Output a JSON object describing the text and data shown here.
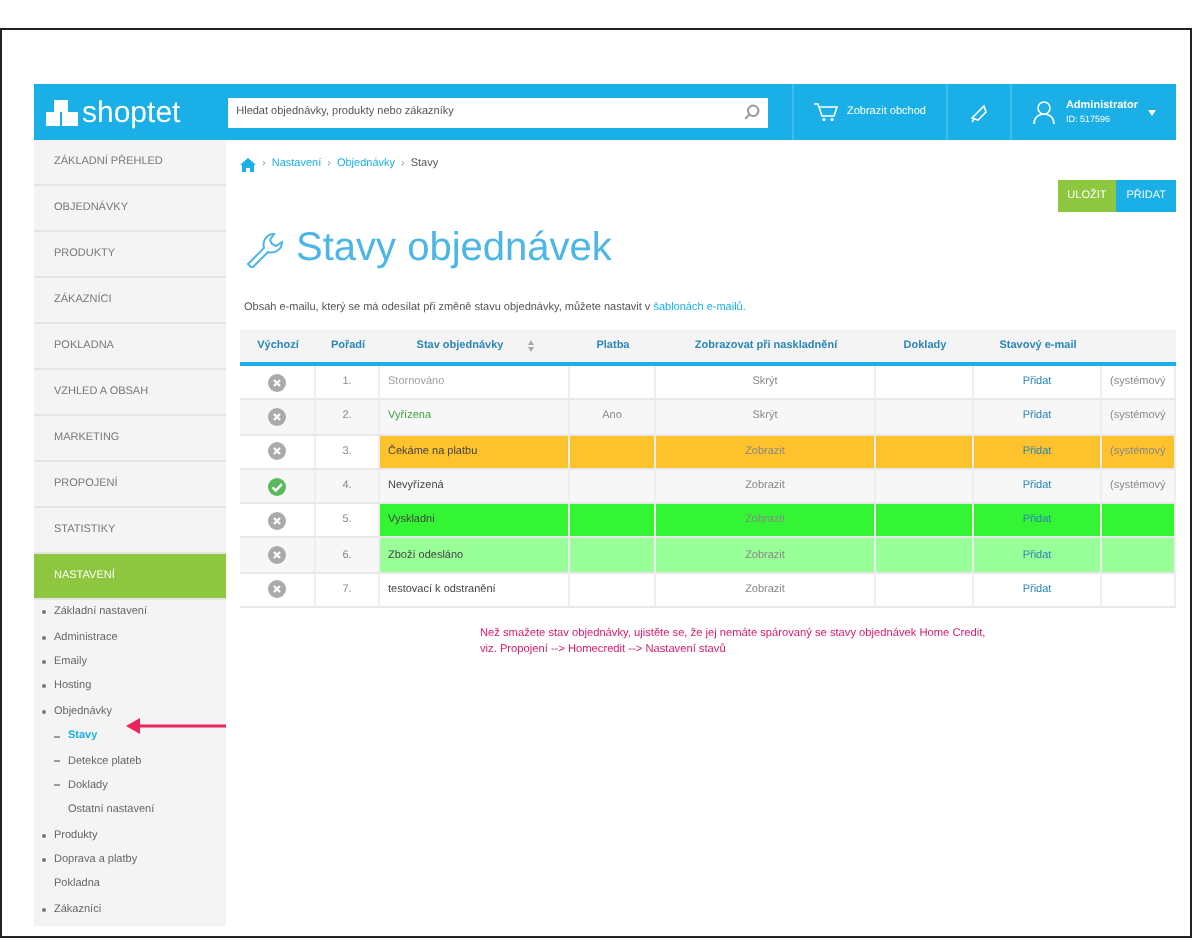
{
  "header": {
    "logo": "shoptet",
    "search": {
      "placeholder": "Hledat objednávky, produkty nebo zákazníky"
    },
    "shop_link": "Zobrazit obchod",
    "user": {
      "name": "Administrator",
      "id": "ID: 517596"
    }
  },
  "sidebar": {
    "items": [
      {
        "label": "ZÁKLADNÍ PŘEHLED",
        "selected": false
      },
      {
        "label": "OBJEDNÁVKY",
        "selected": false
      },
      {
        "label": "PRODUKTY",
        "selected": false
      },
      {
        "label": "ZÁKAZNÍCI",
        "selected": false
      },
      {
        "label": "POKLADNA",
        "selected": false
      },
      {
        "label": "VZHLED A OBSAH",
        "selected": false
      },
      {
        "label": "MARKETING",
        "selected": false
      },
      {
        "label": "PROPOJENÍ",
        "selected": false
      },
      {
        "label": "STATISTIKY",
        "selected": false
      },
      {
        "label": "NASTAVENÍ",
        "selected": true
      }
    ],
    "tree": [
      {
        "label": "Základní nastavení",
        "bullet": true,
        "selected": false
      },
      {
        "label": "Administrace",
        "bullet": true,
        "selected": false
      },
      {
        "label": "Emaily",
        "bullet": true,
        "selected": false
      },
      {
        "label": "Hosting",
        "bullet": true,
        "selected": false
      },
      {
        "label": "Objednávky",
        "bullet": true,
        "selected": false,
        "children": [
          {
            "label": "Stavy",
            "bullet": true,
            "selected": true
          },
          {
            "label": "Detekce plateb",
            "bullet": true,
            "selected": false
          },
          {
            "label": "Doklady",
            "bullet": true,
            "selected": false
          },
          {
            "label": "Ostatní nastavení",
            "bullet": false,
            "selected": false
          }
        ]
      },
      {
        "label": "Produkty",
        "bullet": true,
        "selected": false
      },
      {
        "label": "Doprava a platby",
        "bullet": true,
        "selected": false
      },
      {
        "label": "Pokladna",
        "bullet": false,
        "selected": false
      },
      {
        "label": "Zákazníci",
        "bullet": true,
        "selected": false
      }
    ]
  },
  "breadcrumb": [
    {
      "separator": "›",
      "label": "Nastavení"
    },
    {
      "separator": "›",
      "label": "Objednávky"
    },
    {
      "separator": "›",
      "label": "Stavy"
    }
  ],
  "buttons": [
    {
      "label": "ULOŽIT",
      "kind": "save"
    },
    {
      "label": "PŘIDAT",
      "kind": "add"
    }
  ],
  "title": "Stavy objednávek",
  "description": {
    "text": "Obsah e-mailu, který se má odesílat při změně stavu objednávky, můžete nastavit v ",
    "link": "šablonách e-mailů."
  },
  "table": {
    "columns": [
      "Výchozí",
      "Pořadí",
      "Stav objednávky",
      "Platba",
      "Zobrazovat při naskladnění",
      "Doklady",
      "Stavový e-mail"
    ],
    "rows": [
      {
        "default": false,
        "order": "1.",
        "name": "Stornováno",
        "kind": "muted",
        "payment": "",
        "show": "Skrýt",
        "email": "Přidat",
        "column_8": "(systémový"
      },
      {
        "default": false,
        "order": "2.",
        "name": "Vyřízena",
        "kind": "done",
        "payment": "Ano",
        "show": "Skrýt",
        "email": "Přidat",
        "column_8": "(systémový"
      },
      {
        "default": false,
        "order": "3.",
        "name": "Čekáme na platbu",
        "kind": "normal",
        "color": "#fdc22c",
        "payment": "",
        "show": "Zobrazit",
        "email": "Přidat",
        "column_8": "(systémový"
      },
      {
        "default": true,
        "order": "4.",
        "name": "Nevyřízená",
        "kind": "normal",
        "payment": "",
        "show": "Zobrazit",
        "email": "Přidat",
        "column_8": "(systémový"
      },
      {
        "default": false,
        "order": "5.",
        "name": "Vyskladni",
        "kind": "normal",
        "color": "#33f533",
        "payment": "",
        "show": "Zobrazit",
        "email": "Přidat",
        "column_8": ""
      },
      {
        "default": false,
        "order": "6.",
        "name": "Zboží odesláno",
        "kind": "normal",
        "color": "#99ff99",
        "payment": "",
        "show": "Zobrazit",
        "email": "Přidat",
        "column_8": ""
      },
      {
        "default": false,
        "order": "7.",
        "name": "testovací k odstranění",
        "kind": "normal",
        "payment": "",
        "show": "Zobrazit",
        "email": "Přidat",
        "column_8": ""
      }
    ]
  },
  "warning": [
    "Než smažete stav objednávky, ujistěte se, že jej nemáte spárovaný se stavy objednávek Home Credit,",
    "viz. Propojení --> Homecredit --> Nastavení stavů"
  ]
}
